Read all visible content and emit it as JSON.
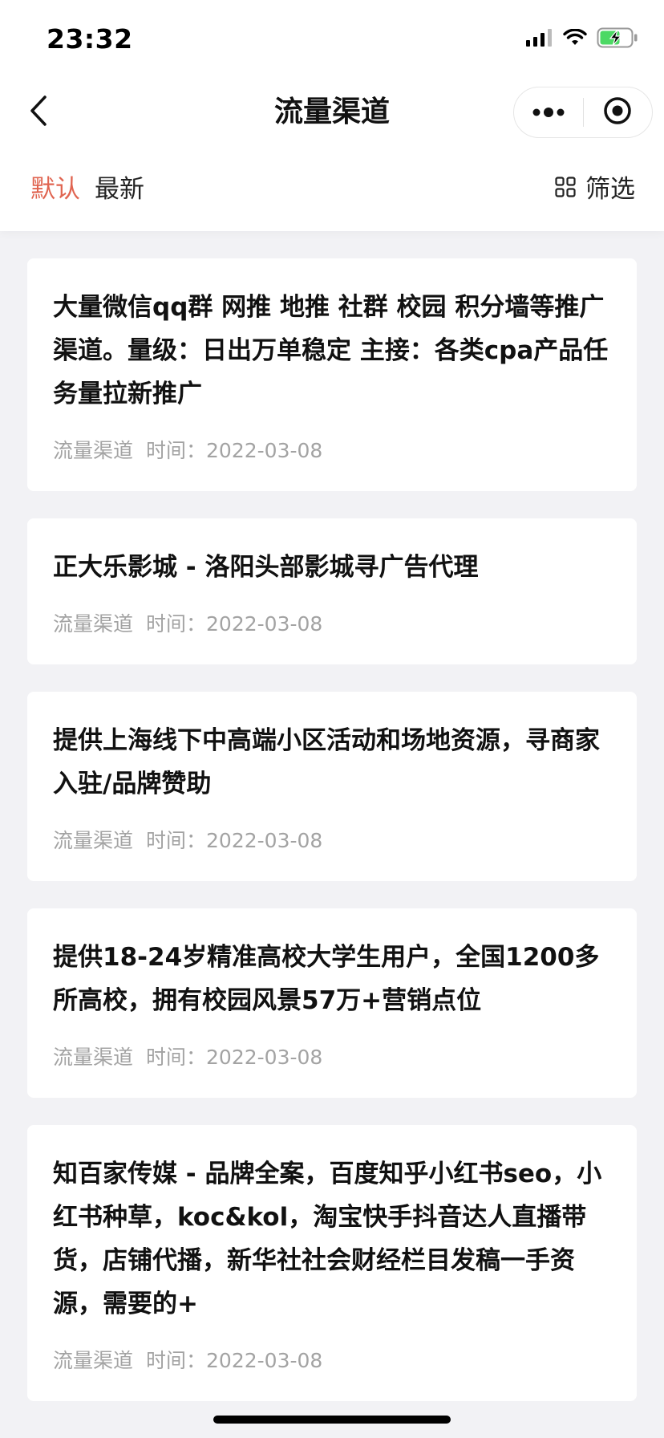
{
  "status_bar": {
    "time": "23:32"
  },
  "nav": {
    "title": "流量渠道",
    "back_icon": "chevron-left-icon",
    "more_icon": "more-dots-icon",
    "close_icon": "target-circle-icon"
  },
  "tabs": [
    {
      "label": "默认",
      "active": true
    },
    {
      "label": "最新",
      "active": false
    }
  ],
  "filter": {
    "label": "筛选",
    "icon": "grid-icon"
  },
  "accent_color": "#e06450",
  "items": [
    {
      "title": "大量微信qq群 网推 地推 社群 校园 积分墙等推广渠道。量级：日出万单稳定 主接：各类cpa产品任务量拉新推广",
      "category": "流量渠道",
      "time": "时间：2022-03-08"
    },
    {
      "title": "正大乐影城 - 洛阳头部影城寻广告代理",
      "category": "流量渠道",
      "time": "时间：2022-03-08"
    },
    {
      "title": "提供上海线下中高端小区活动和场地资源，寻商家入驻/品牌赞助",
      "category": "流量渠道",
      "time": "时间：2022-03-08"
    },
    {
      "title": "提供18-24岁精准高校大学生用户，全国1200多所高校，拥有校园风景57万+营销点位",
      "category": "流量渠道",
      "time": "时间：2022-03-08"
    },
    {
      "title": "知百家传媒 - 品牌全案，百度知乎小红书seo，小红书种草，koc&kol，淘宝快手抖音达人直播带货，店铺代播，新华社社会财经栏目发稿一手资源，需要的+",
      "category": "流量渠道",
      "time": "时间：2022-03-08"
    }
  ]
}
